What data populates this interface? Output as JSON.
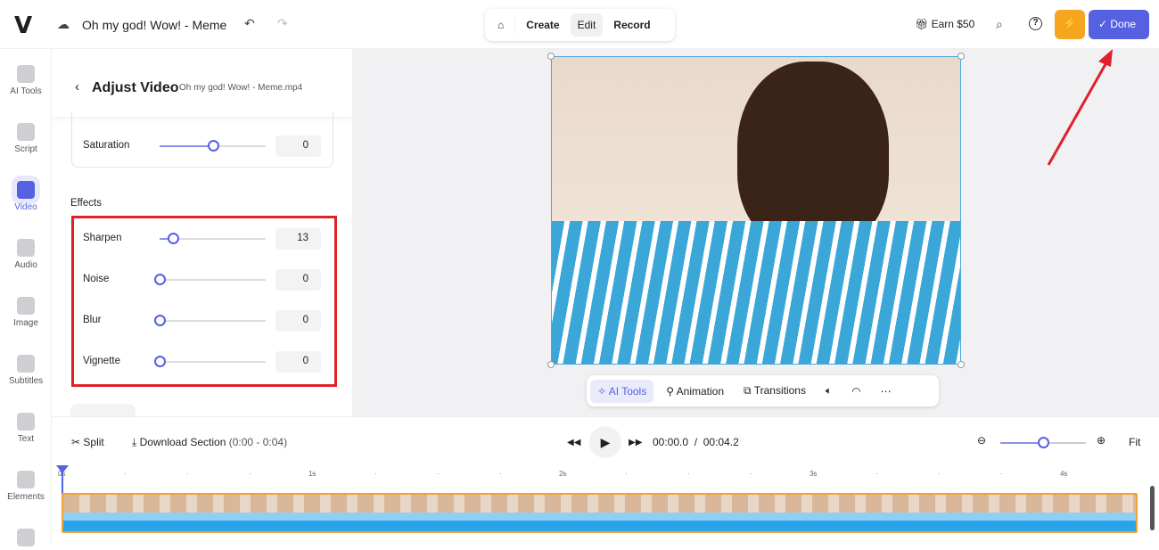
{
  "header": {
    "logo": "V",
    "project_title": "Oh my god! Wow! - Meme",
    "nav": [
      "Create",
      "Edit",
      "Record"
    ],
    "active_nav": "Edit",
    "earn": "Earn $50",
    "done": "Done"
  },
  "rail": [
    {
      "label": "AI Tools"
    },
    {
      "label": "Script"
    },
    {
      "label": "Video",
      "active": true
    },
    {
      "label": "Audio"
    },
    {
      "label": "Image"
    },
    {
      "label": "Subtitles"
    },
    {
      "label": "Text"
    },
    {
      "label": "Elements"
    }
  ],
  "panel": {
    "title": "Adjust Video",
    "subtitle": "Oh my god! Wow! - Meme.mp4",
    "saturation": {
      "label": "Saturation",
      "value": "0",
      "fraction": 0.5
    },
    "effects_heading": "Effects",
    "effects": [
      {
        "label": "Sharpen",
        "value": "13",
        "fraction": 0.13
      },
      {
        "label": "Noise",
        "value": "0",
        "fraction": 0
      },
      {
        "label": "Blur",
        "value": "0",
        "fraction": 0
      },
      {
        "label": "Vignette",
        "value": "0",
        "fraction": 0
      }
    ]
  },
  "video_toolbar": {
    "ai_tools": "AI Tools",
    "animation": "Animation",
    "transitions": "Transitions"
  },
  "timeline": {
    "split": "Split",
    "download": "Download Section",
    "range": "(0:00 - 0:04)",
    "current": "00:00.0",
    "separator": "/",
    "total": "00:04.2",
    "fit": "Fit",
    "zoom_fraction": 0.5,
    "ticks": [
      "0s",
      "1s",
      "2s",
      "3s",
      "4s"
    ]
  },
  "colors": {
    "accent": "#5561e0",
    "orange": "#f6a51f",
    "highlight": "#e0202a"
  }
}
